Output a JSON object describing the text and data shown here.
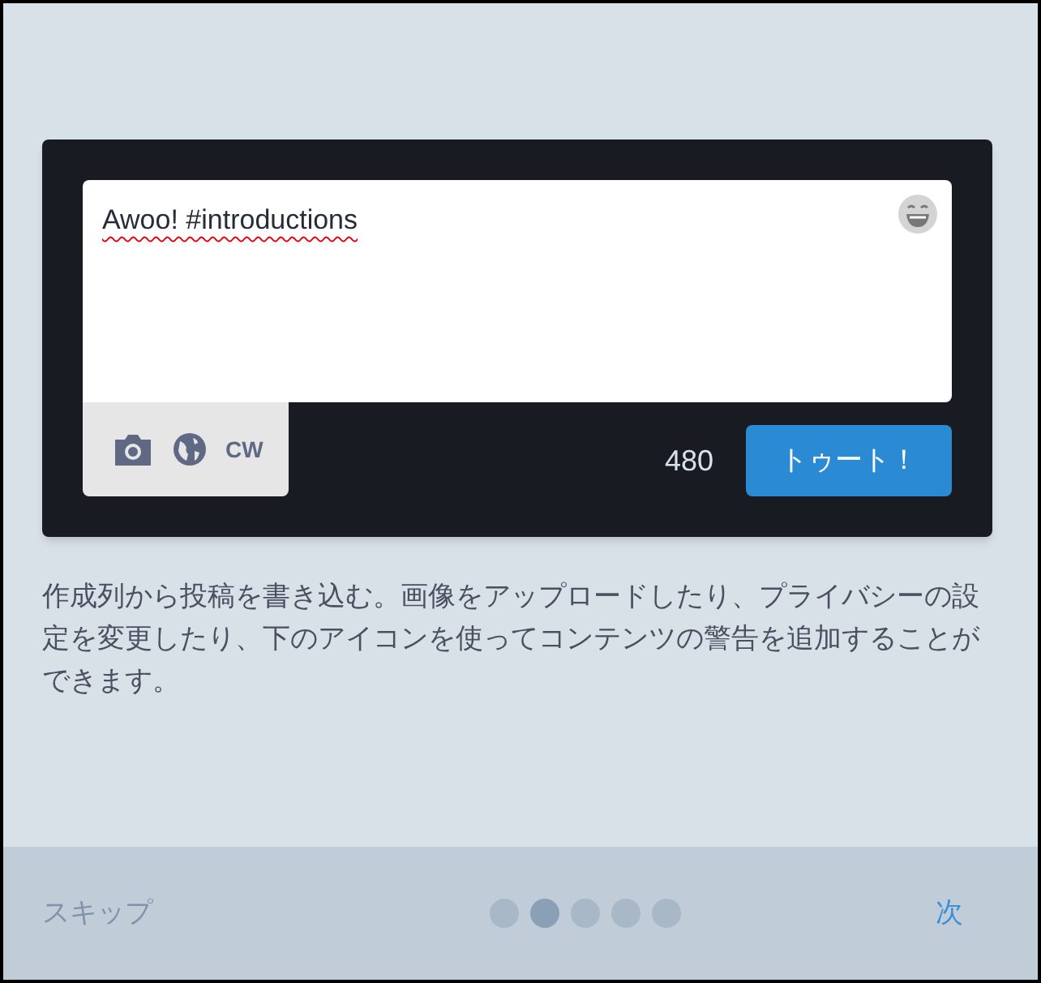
{
  "composer": {
    "value": "Awoo! #introductions",
    "cw_label": "CW",
    "counter": "480",
    "submit": "トゥート！"
  },
  "description": "作成列から投稿を書き込む。画像をアップロードしたり、プライバシーの設定を変更したり、下のアイコンを使ってコンテンツの警告を追加することができます。",
  "footer": {
    "skip": "スキップ",
    "next": "次",
    "pages": [
      {
        "selected": false
      },
      {
        "selected": true
      },
      {
        "selected": false
      },
      {
        "selected": false
      },
      {
        "selected": false
      }
    ]
  }
}
